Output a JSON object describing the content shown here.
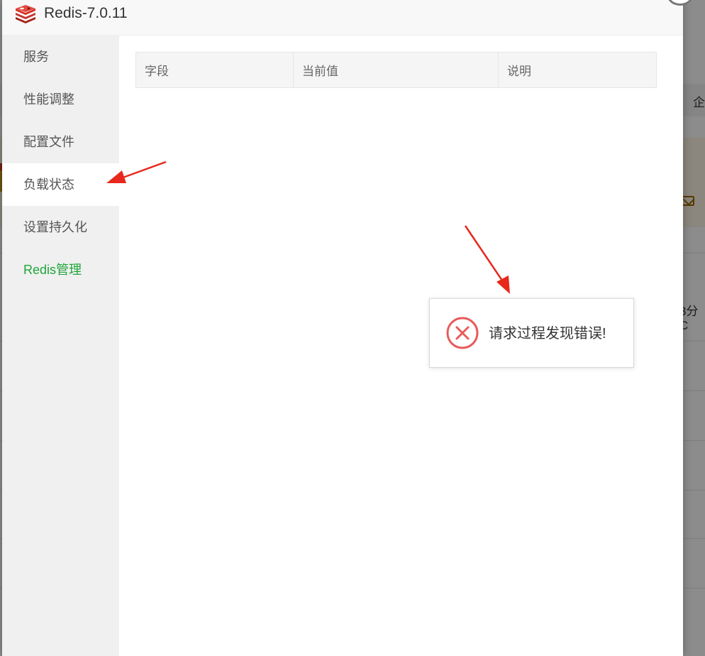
{
  "dialog": {
    "title": "Redis-7.0.11",
    "logo_icon": "redis-logo-icon",
    "close_icon": "close-icon"
  },
  "sidebar": {
    "items": [
      {
        "label": "服务"
      },
      {
        "label": "性能调整"
      },
      {
        "label": "配置文件"
      },
      {
        "label": "负载状态"
      },
      {
        "label": "设置持久化"
      },
      {
        "label": "Redis管理"
      }
    ],
    "active_index": 3
  },
  "table": {
    "headers": [
      "字段",
      "当前值",
      "说明"
    ],
    "rows": []
  },
  "toast": {
    "message": "请求过程发现错误!",
    "icon": "error-circle-icon",
    "icon_color": "#e85b5b"
  },
  "background": {
    "tab_fragment": "企",
    "cell_fragment": "3分C"
  },
  "colors": {
    "accent_green": "#20a53a",
    "annotation_arrow": "#e8281c",
    "overlay": "#8f8f8f"
  }
}
